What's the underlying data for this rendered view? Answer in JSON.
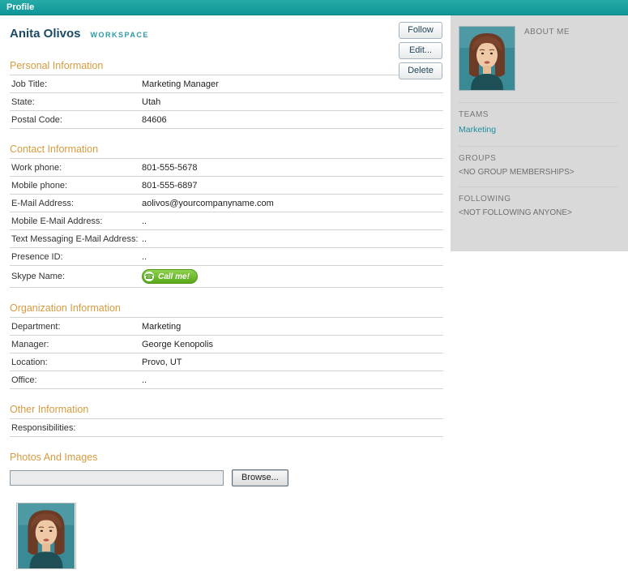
{
  "topbar": {
    "title": "Profile"
  },
  "header": {
    "name": "Anita Olivos",
    "workspace_label": "Workspace"
  },
  "actions": {
    "follow": "Follow",
    "edit": "Edit...",
    "delete": "Delete"
  },
  "sections": {
    "personal": {
      "title": "Personal Information",
      "rows": [
        {
          "label": "Job Title:",
          "value": "Marketing Manager"
        },
        {
          "label": "State:",
          "value": "Utah"
        },
        {
          "label": "Postal Code:",
          "value": "84606"
        }
      ]
    },
    "contact": {
      "title": "Contact Information",
      "rows": [
        {
          "label": "Work phone:",
          "value": "801-555-5678"
        },
        {
          "label": "Mobile phone:",
          "value": "801-555-6897"
        },
        {
          "label": "E-Mail Address:",
          "value": "aolivos@yourcompanyname.com"
        },
        {
          "label": "Mobile E-Mail Address:",
          "value": ".."
        },
        {
          "label": "Text Messaging E-Mail Address:",
          "value": ".."
        },
        {
          "label": "Presence ID:",
          "value": ".."
        },
        {
          "label": "Skype Name:",
          "value": ""
        }
      ],
      "skype_button_label": "Call me!"
    },
    "organization": {
      "title": "Organization Information",
      "rows": [
        {
          "label": "Department:",
          "value": "Marketing"
        },
        {
          "label": "Manager:",
          "value": "George Kenopolis"
        },
        {
          "label": "Location:",
          "value": "Provo, UT"
        },
        {
          "label": "Office:",
          "value": ".."
        }
      ]
    },
    "other": {
      "title": "Other Information",
      "rows": [
        {
          "label": "Responsibilities:",
          "value": ""
        }
      ]
    },
    "photos": {
      "title": "Photos And Images",
      "file_input_value": "",
      "browse_label": "Browse..."
    }
  },
  "sidebar": {
    "about_me_label": "ABOUT ME",
    "teams_label": "TEAMS",
    "team_link": "Marketing",
    "groups_label": "GROUPS",
    "groups_empty": "<NO GROUP MEMBERSHIPS>",
    "following_label": "FOLLOWING",
    "following_empty": "<NOT FOLLOWING ANYONE>"
  },
  "icons": {
    "skype_phone": "phone-icon"
  },
  "colors": {
    "topbar_teal": "#129b9b",
    "section_heading_orange": "#d79b3f",
    "link_teal": "#1d8da2",
    "name_blue": "#1b4a66",
    "sidebar_gray": "#d9d9d9",
    "skype_green": "#58a918"
  }
}
